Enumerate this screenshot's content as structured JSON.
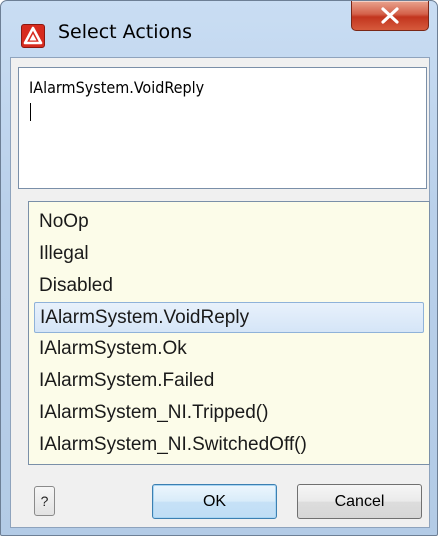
{
  "window": {
    "title": "Select Actions",
    "app_icon": "app-logo-icon",
    "close_icon": "close-icon"
  },
  "editor": {
    "value": "IAlarmSystem.VoidReply"
  },
  "actions_list": {
    "items": [
      "NoOp",
      "Illegal",
      "Disabled",
      "IAlarmSystem.VoidReply",
      "IAlarmSystem.Ok",
      "IAlarmSystem.Failed",
      "IAlarmSystem_NI.Tripped()",
      "IAlarmSystem_NI.SwitchedOff()"
    ],
    "selected": "IAlarmSystem.VoidReply"
  },
  "buttons": {
    "help_label": "?",
    "ok_label": "OK",
    "cancel_label": "Cancel"
  },
  "colors": {
    "list_background": "#fcfce9",
    "selection": "#d5e5f7",
    "close_button": "#c2351e",
    "app_icon": "#d72b1f"
  }
}
